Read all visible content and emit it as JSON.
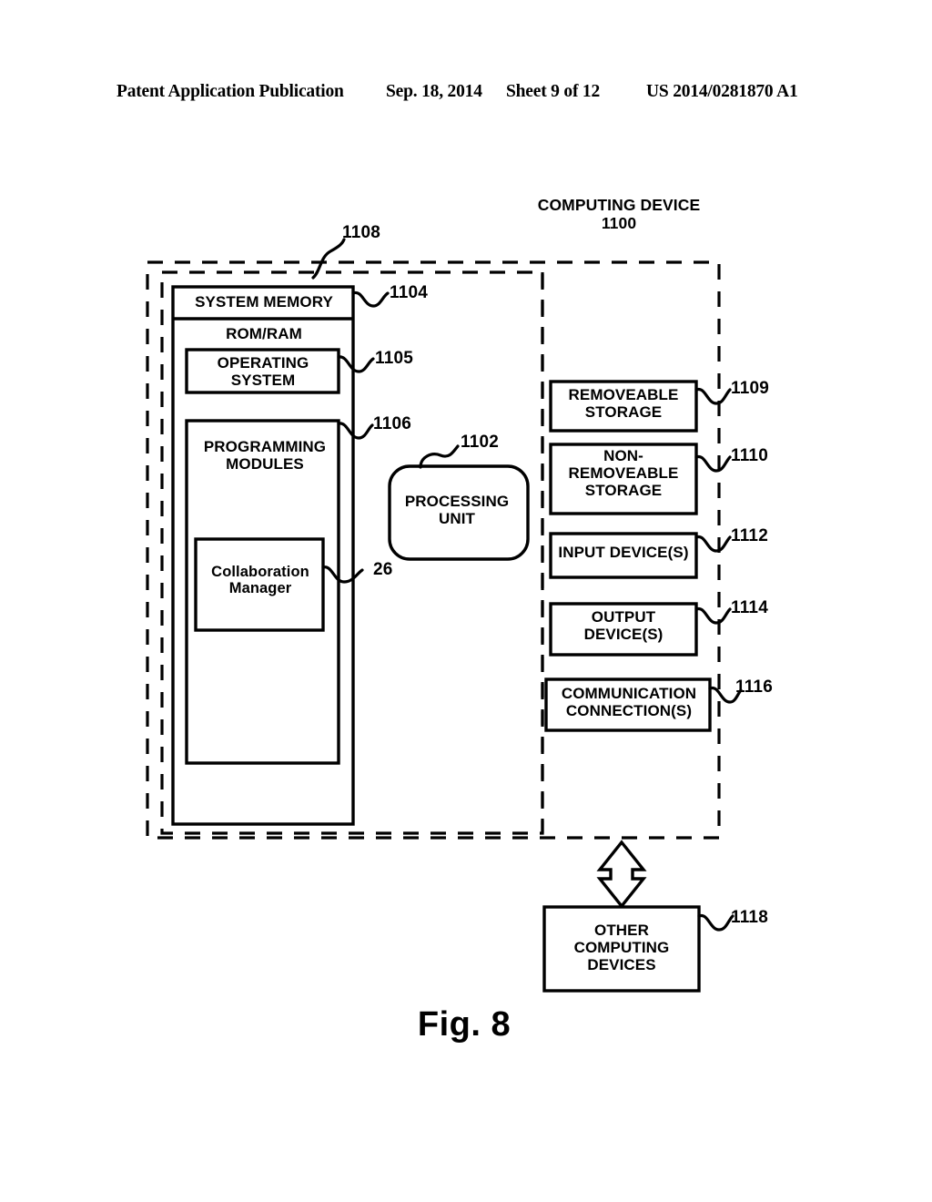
{
  "header": {
    "publication": "Patent Application Publication",
    "date": "Sep. 18, 2014",
    "sheet": "Sheet 9 of 12",
    "patent_number": "US 2014/0281870 A1"
  },
  "figure": {
    "caption": "Fig. 8",
    "title": "COMPUTING DEVICE",
    "title_ref": "1100"
  },
  "blocks": {
    "system_memory": {
      "label": "SYSTEM MEMORY",
      "ref": "1104"
    },
    "rom_ram": {
      "label": "ROM/RAM"
    },
    "operating_system": {
      "label": "OPERATING\nSYSTEM",
      "ref": "1105"
    },
    "programming_modules": {
      "label": "PROGRAMMING\nMODULES",
      "ref": "1106"
    },
    "collaboration_manager": {
      "label": "Collaboration\nManager",
      "ref": "26"
    },
    "processing_unit": {
      "label": "PROCESSING\nUNIT",
      "ref": "1102"
    },
    "removeable_storage": {
      "label": "REMOVEABLE\nSTORAGE",
      "ref": "1109"
    },
    "non_removeable_storage": {
      "label": "NON-\nREMOVEABLE\nSTORAGE",
      "ref": "1110"
    },
    "input_devices": {
      "label": "INPUT DEVICE(S)",
      "ref": "1112"
    },
    "output_devices": {
      "label": "OUTPUT\nDEVICE(S)",
      "ref": "1114"
    },
    "communication_connections": {
      "label": "COMMUNICATION\nCONNECTION(S)",
      "ref": "1116"
    },
    "other_computing_devices": {
      "label": "OTHER\nCOMPUTING\nDEVICES",
      "ref": "1118"
    },
    "system_memory_outer": {
      "ref": "1108"
    }
  },
  "colors": {
    "ink": "#000000",
    "background": "#ffffff"
  }
}
